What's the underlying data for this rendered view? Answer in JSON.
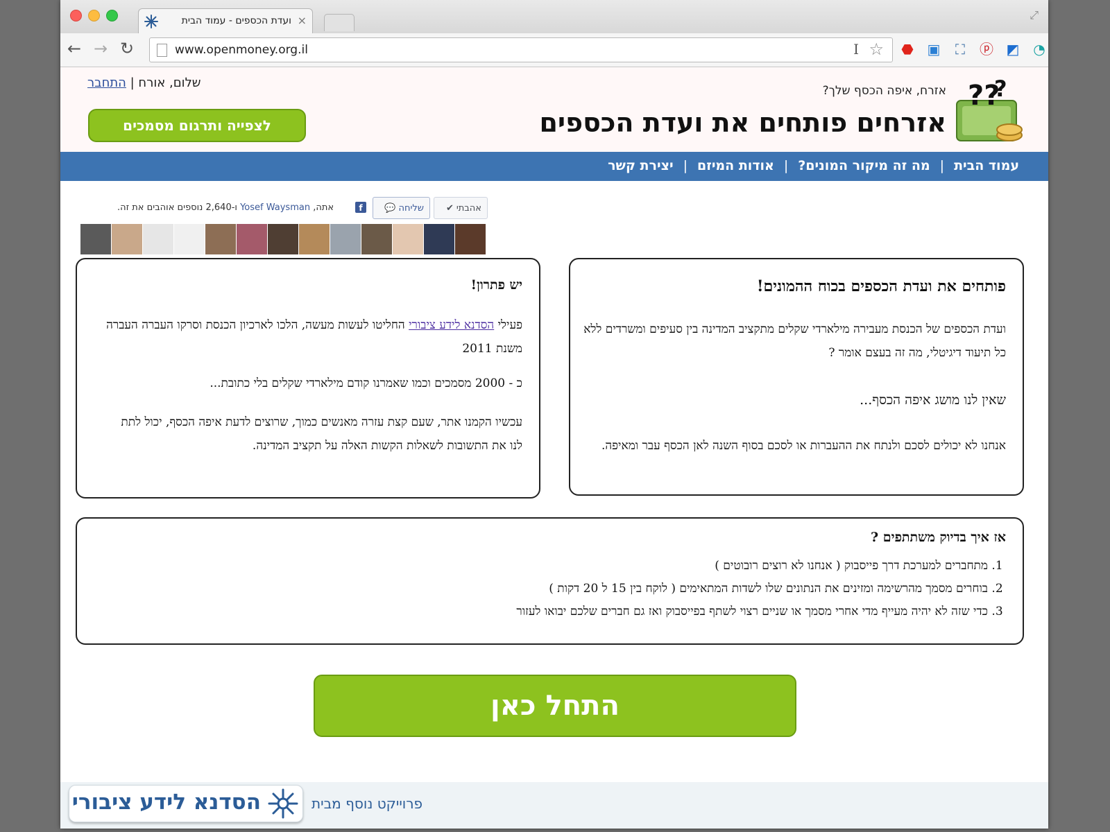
{
  "browser": {
    "tab_title": "ועדת הכספים - עמוד הבית",
    "url": "www.openmoney.org.il",
    "reader_glyph": "I"
  },
  "site": {
    "tagline": "אזרח, איפה הכסף שלך?",
    "title": "אזרחים פותחים את ועדת הכספים",
    "greeting": "שלום, אורח | ",
    "login_link": "התחבר",
    "watch_button": "לצפייה ותרגום מסמכים"
  },
  "nav": {
    "items": [
      "עמוד הבית",
      "מה זה מיקור המונים?",
      "אודות המיזם",
      "יצירת קשר"
    ]
  },
  "facebook": {
    "like_label": "אהבתי",
    "send_label": "שליחה",
    "text_prefix": "אתה, ",
    "friend_name": "Yosef Waysman",
    "text_suffix": " ו-2,640 נוספים אוהבים את זה."
  },
  "box_right": {
    "heading": "פותחים את ועדת הכספים בכוח ההמונים!",
    "p1": "ועדת הכספים של הכנסת מעבירה מילארדי שקלים מתקציב המדינה בין סעיפים ומשרדים ללא כל תיעוד דיגיטלי, מה זה בעצם אומר ?",
    "p2": "שאין לנו מושג איפה הכסף...",
    "p3": "אנחנו לא יכולים לסכם ולנתח את ההעברות או לסכם בסוף השנה לאן הכסף עבר ומאיפה."
  },
  "box_left": {
    "heading": "יש פתרון!",
    "p1_pre": "פעילי ",
    "p1_link": "הסדנא לידע ציבורי",
    "p1_post": " החליטו לעשות מעשה, הלכו לארכיון הכנסת וסרקו העברה העברה משנת 2011",
    "p2": "כ - 2000 מסמכים וכמו שאמרנו קודם מילארדי שקלים בלי כתובת...",
    "p3": "עכשיו הקמנו אתר, שעם קצת עזרה מאנשים כמוך, שרוצים לדעת איפה הכסף, יכול לתת לנו את התשובות לשאלות הקשות האלה על תקציב המדינה."
  },
  "box_bottom": {
    "heading": "אז איך בדיוק משתתפים ?",
    "steps": [
      "מתחברים למערכת דרך פייסבוק ( אנחנו לא רוצים רובוטים )",
      "בוחרים מסמך מהרשימה ומזינים את הנתונים שלו לשדות המתאימים ( לוקח בין 15 ל 20 דקות )",
      "כדי שזה לא יהיה מעייף מדי אחרי מסמך או שניים רצוי לשתף בפייסבוק ואז גם חברים שלכם יבואו לעזור"
    ]
  },
  "start_button": "התחל כאן",
  "footer": {
    "logo_text": "הסדנא לידע ציבורי",
    "note": "פרוייקט נוסף מבית"
  },
  "colors": {
    "nav_blue": "#3d74b2",
    "button_green": "#8dc21f",
    "link_blue": "#2a4d9c"
  }
}
